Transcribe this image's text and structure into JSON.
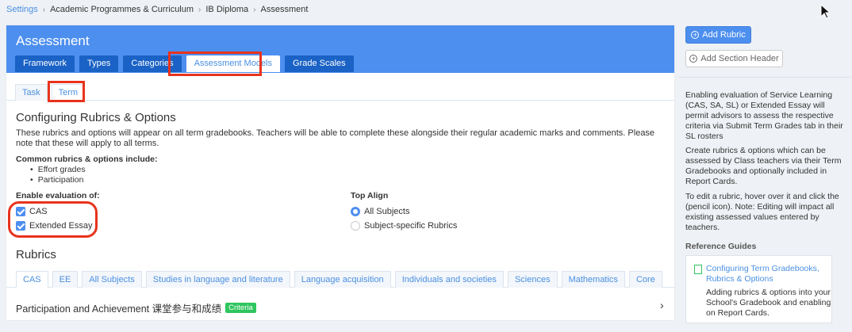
{
  "breadcrumb": {
    "items": [
      "Settings",
      "Academic Programmes & Curriculum",
      "IB Diploma",
      "Assessment"
    ],
    "separator": "›"
  },
  "header": {
    "title": "Assessment",
    "tabs": [
      "Framework",
      "Types",
      "Categories",
      "Assessment Models",
      "Grade Scales"
    ],
    "active_tab": "Assessment Models"
  },
  "sub_tabs": [
    "Task",
    "Term"
  ],
  "config": {
    "title": "Configuring Rubrics & Options",
    "description": "These rubrics and options will appear on all term gradebooks. Teachers will be able to complete these alongside their regular academic marks and comments. Please note that these will apply to all terms.",
    "common_label": "Common rubrics & options include:",
    "common_items": [
      "Effort grades",
      "Participation"
    ],
    "enable_label": "Enable evaluation of:",
    "enable_options": [
      "CAS",
      "Extended Essay"
    ],
    "top_align_label": "Top Align",
    "top_align_options": [
      "All Subjects",
      "Subject-specific Rubrics"
    ],
    "top_align_selected": "All Subjects"
  },
  "rubrics": {
    "title": "Rubrics",
    "tabs": [
      "CAS",
      "EE",
      "All Subjects",
      "Studies in language and literature",
      "Language acquisition",
      "Individuals and societies",
      "Sciences",
      "Mathematics",
      "Core"
    ],
    "active_tab": "CAS",
    "row": {
      "label": "Participation and Achievement 课堂参与和成绩",
      "badge": "Criteria"
    }
  },
  "sidebar": {
    "add_rubric": "Add Rubric",
    "add_section_header": "Add Section Header",
    "info_1": "Enabling evaluation of Service Learning (CAS, SA, SL) or Extended Essay will permit advisors to assess the respective criteria via Submit Term Grades tab in their SL rosters",
    "info_2": "Create rubrics & options which can be assessed by Class teachers via their Term Gradebooks and optionally included in Report Cards.",
    "info_3": "To edit a rubric, hover over it and click the (pencil icon). Note: Editing will impact all existing assessed values entered by teachers.",
    "reference_title": "Reference Guides",
    "reference_link": "Configuring Term Gradebooks, Rubrics & Options",
    "reference_desc": "Adding rubrics & options into your School's Gradebook and enabling on Report Cards."
  },
  "colors": {
    "primary": "#4d8fef",
    "tab_dark": "#1a62c5",
    "highlight": "#e8331c",
    "badge": "#2fc55e"
  }
}
